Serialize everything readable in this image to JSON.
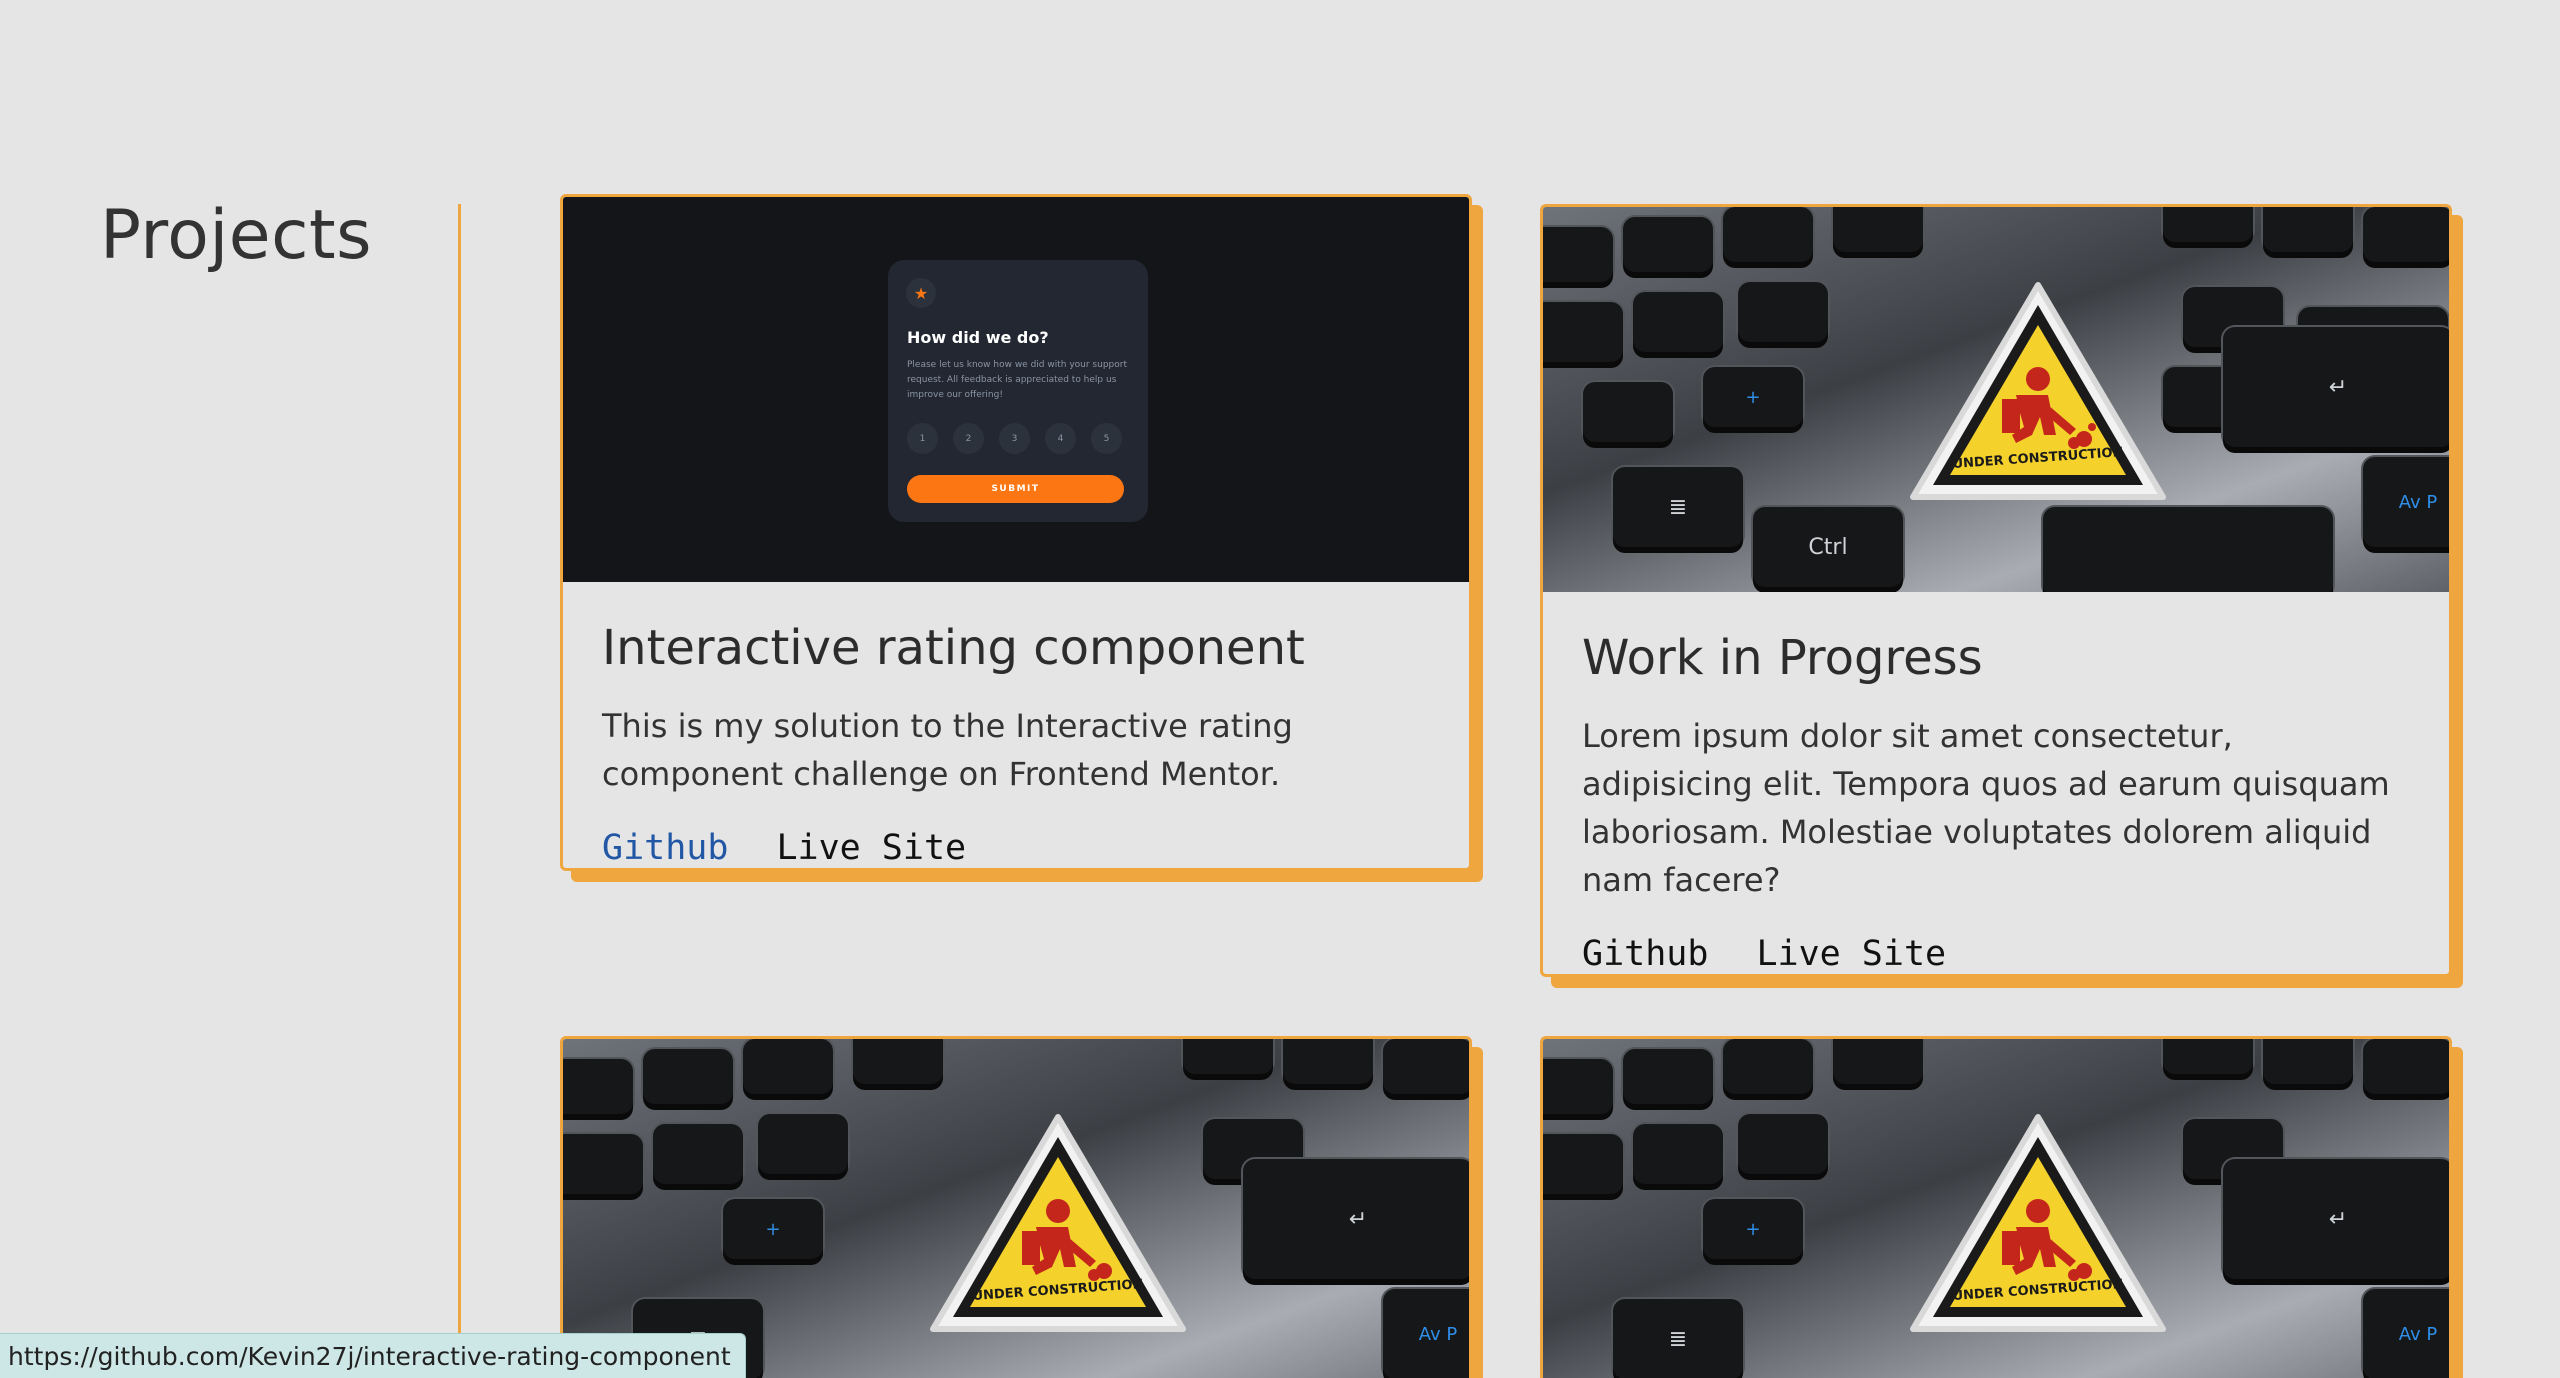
{
  "section": {
    "title": "Projects"
  },
  "projects": [
    {
      "title": "Interactive rating component",
      "description": "This is my solution to the Interactive rating component challenge on Frontend Mentor.",
      "github_label": "Github",
      "live_label": "Live Site",
      "preview": {
        "question": "How did we do?",
        "text": "Please let us know how we did with your support request. All feedback is appreciated to help us improve our offering!",
        "ratings": [
          "1",
          "2",
          "3",
          "4",
          "5"
        ],
        "submit_label": "SUBMIT",
        "accent": "#fc7614"
      }
    },
    {
      "title": "Work in Progress",
      "description": "Lorem ipsum dolor sit amet consectetur, adipisicing elit. Tempora quos ad earum quisquam laboriosam. Molestiae voluptates dolorem aliquid nam facere?",
      "github_label": "Github",
      "live_label": "Live Site",
      "sign_text": "UNDER CONSTRUCTION"
    },
    {
      "sign_text": "UNDER CONSTRUCTION"
    },
    {
      "sign_text": "UNDER CONSTRUCTION"
    }
  ],
  "status_bar": {
    "url": "https://github.com/Kevin27j/interactive-rating-component"
  },
  "colors": {
    "accent": "#f0a63e",
    "link_hover": "#2257a5",
    "background": "#e5e5e5"
  }
}
